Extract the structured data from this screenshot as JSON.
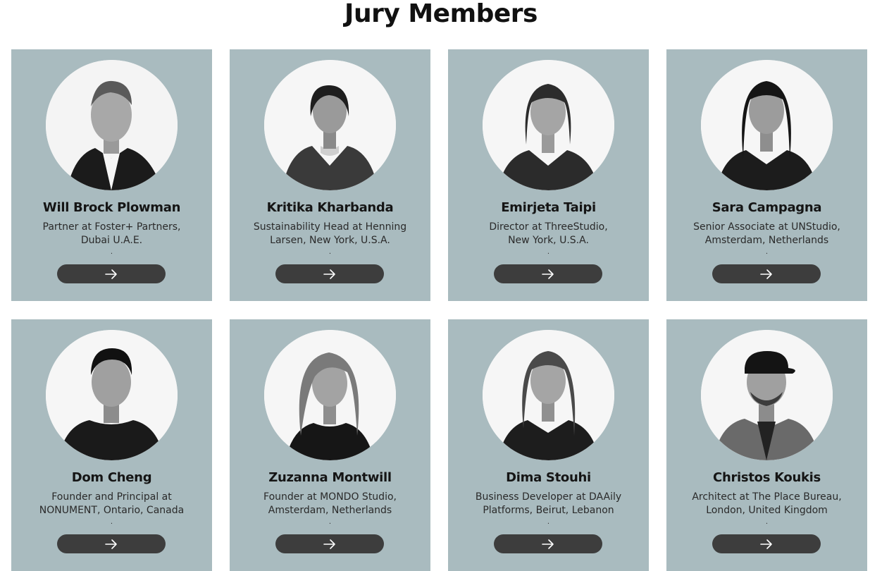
{
  "page": {
    "title": "Jury Members"
  },
  "colors": {
    "card_background": "#a9bbbf",
    "button_background": "#3d3d3d",
    "title": "#111111"
  },
  "jury": [
    {
      "name": "Will Brock Plowman",
      "role_line1": "Partner at Foster+ Partners,",
      "role_line2": "Dubai U.A.E.",
      "separator": ".",
      "button_icon": "arrow-right-icon"
    },
    {
      "name": "Kritika Kharbanda",
      "role_line1": "Sustainability Head at Henning",
      "role_line2": "Larsen, New York, U.S.A.",
      "separator": ".",
      "button_icon": "arrow-right-icon"
    },
    {
      "name": "Emirjeta Taipi",
      "role_line1": "Director at ThreeStudio,",
      "role_line2": "New York, U.S.A.",
      "separator": ".",
      "button_icon": "arrow-right-icon"
    },
    {
      "name": "Sara Campagna",
      "role_line1": "Senior Associate at UNStudio,",
      "role_line2": "Amsterdam, Netherlands",
      "separator": ".",
      "button_icon": "arrow-right-icon"
    },
    {
      "name": "Dom Cheng",
      "role_line1": "Founder and Principal at",
      "role_line2": "NONUMENT, Ontario, Canada",
      "separator": ".",
      "button_icon": "arrow-right-icon"
    },
    {
      "name": "Zuzanna Montwill",
      "role_line1": "Founder at MONDO Studio,",
      "role_line2": "Amsterdam, Netherlands",
      "separator": ".",
      "button_icon": "arrow-right-icon"
    },
    {
      "name": "Dima Stouhi",
      "role_line1": "Business Developer at DAAily",
      "role_line2": "Platforms, Beirut, Lebanon",
      "separator": ".",
      "button_icon": "arrow-right-icon"
    },
    {
      "name": "Christos Koukis",
      "role_line1": "Architect at The Place Bureau,",
      "role_line2": "London, United Kingdom",
      "separator": ".",
      "button_icon": "arrow-right-icon"
    }
  ]
}
